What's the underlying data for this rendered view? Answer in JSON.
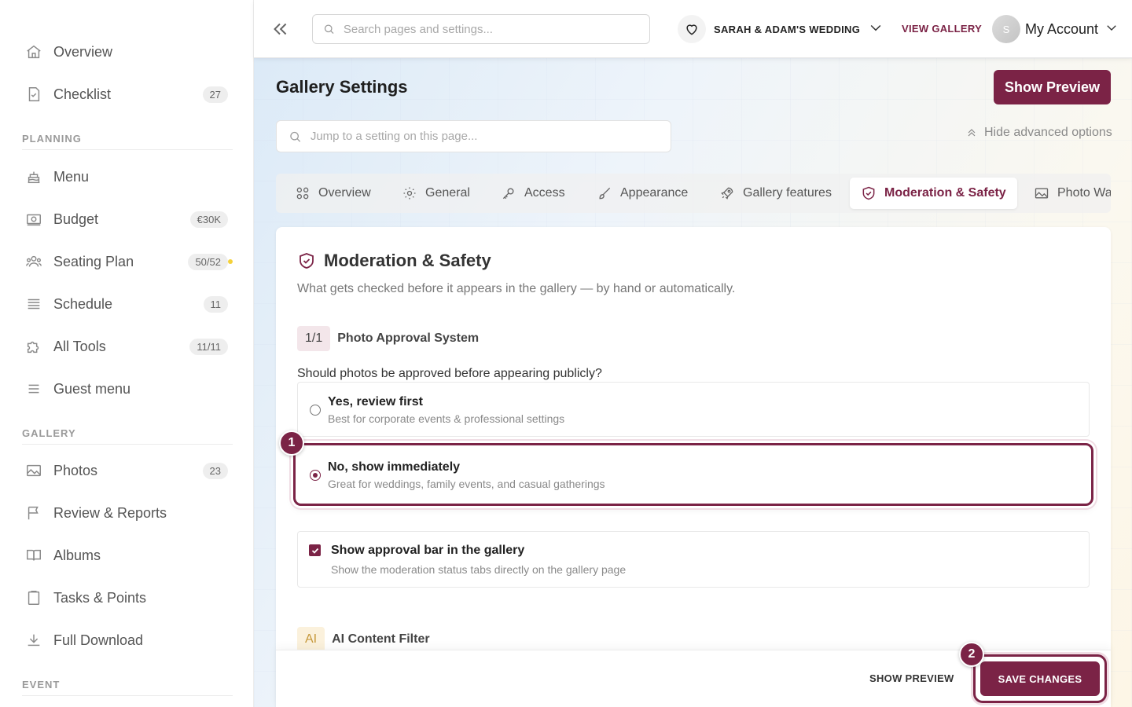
{
  "sidebar": {
    "items": [
      {
        "label": "Overview"
      },
      {
        "label": "Checklist",
        "badge": "27"
      },
      {
        "label": "Menu"
      },
      {
        "label": "Budget",
        "badge": "€30K"
      },
      {
        "label": "Seating Plan",
        "badge": "50/52"
      },
      {
        "label": "Schedule",
        "badge": "11"
      },
      {
        "label": "All Tools",
        "badge": "11/11"
      },
      {
        "label": "Guest menu"
      },
      {
        "label": "Photos",
        "badge": "23"
      },
      {
        "label": "Review & Reports"
      },
      {
        "label": "Albums"
      },
      {
        "label": "Tasks & Points"
      },
      {
        "label": "Full Download"
      }
    ],
    "sections": {
      "planning": "PLANNING",
      "gallery": "GALLERY",
      "event": "EVENT"
    }
  },
  "topbar": {
    "search_placeholder": "Search pages and settings...",
    "wedding_name": "SARAH & ADAM'S WEDDING",
    "view_gallery": "VIEW GALLERY",
    "avatar_initial": "S",
    "account_label": "My Account"
  },
  "page": {
    "title": "Gallery Settings",
    "show_preview": "Show Preview",
    "jump_placeholder": "Jump to a setting on this page...",
    "hide_advanced": "Hide advanced options"
  },
  "tabs": [
    {
      "label": "Overview"
    },
    {
      "label": "General"
    },
    {
      "label": "Access"
    },
    {
      "label": "Appearance"
    },
    {
      "label": "Gallery features"
    },
    {
      "label": "Moderation & Safety"
    },
    {
      "label": "Photo Wa"
    }
  ],
  "card": {
    "title": "Moderation & Safety",
    "subtitle": "What gets checked before it appears in the gallery — by hand or automatically.",
    "step_counter": "1/1",
    "step_title": "Photo Approval System",
    "question": "Should photos be approved before appearing publicly?",
    "options": [
      {
        "title": "Yes, review first",
        "desc": "Best for corporate events & professional settings"
      },
      {
        "title": "No, show immediately",
        "desc": "Great for weddings, family events, and casual gatherings"
      }
    ],
    "approval_bar": {
      "title": "Show approval bar in the gallery",
      "desc": "Show the moderation status tabs directly on the gallery page"
    },
    "ai_chip": "AI",
    "ai_title": "AI Content Filter"
  },
  "footer": {
    "show_preview": "SHOW PREVIEW",
    "save": "SAVE CHANGES"
  },
  "steps": {
    "one": "1",
    "two": "2"
  },
  "colors": {
    "accent": "#7b2346",
    "dot": "#f4d13a"
  }
}
